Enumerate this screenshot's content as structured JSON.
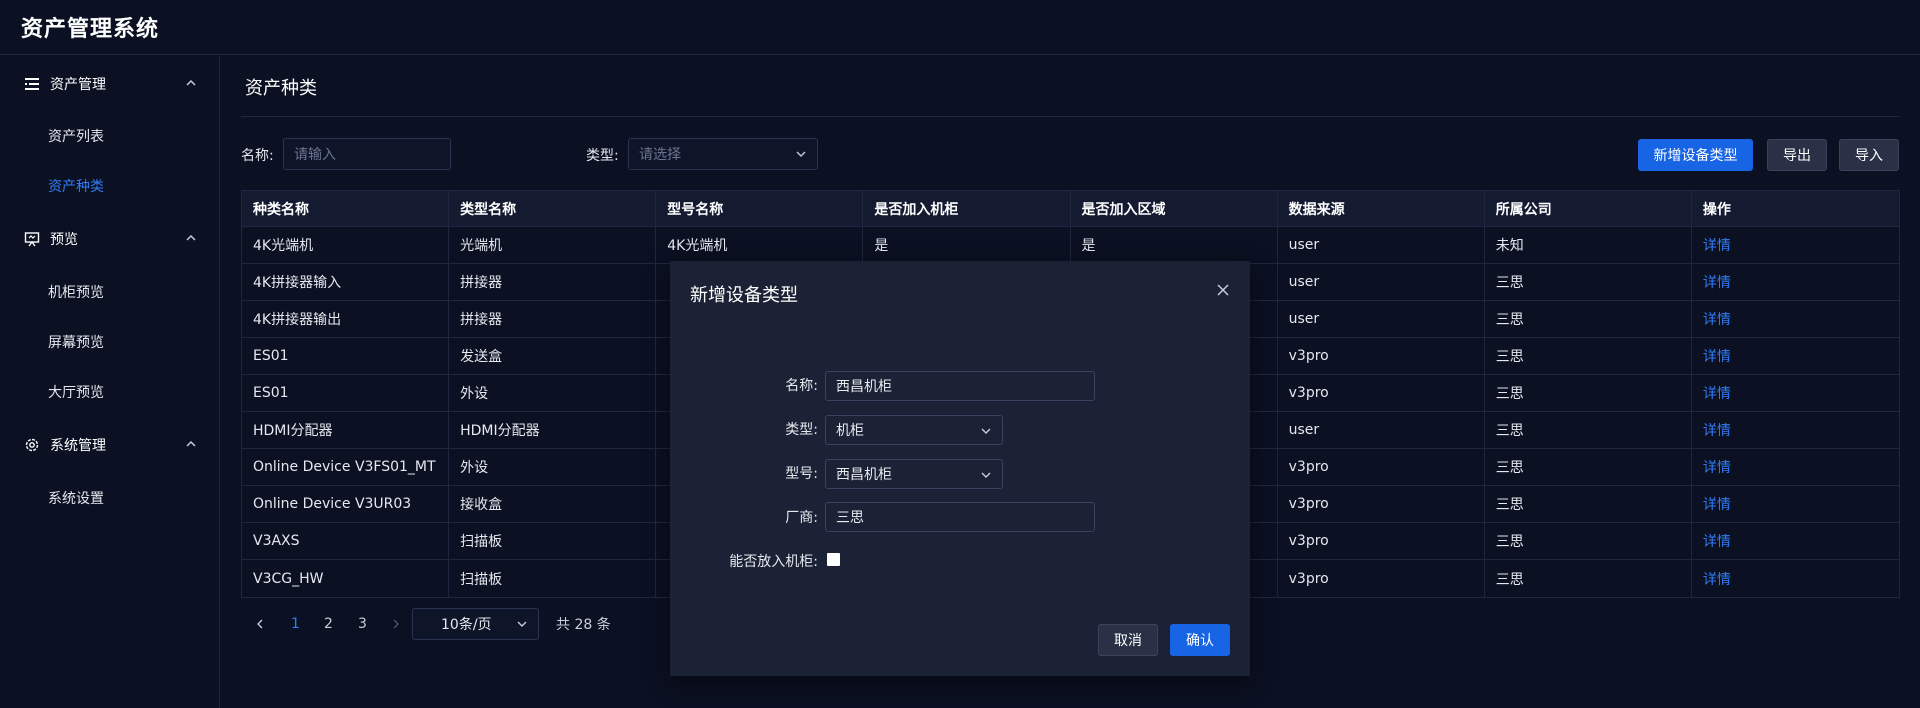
{
  "app": {
    "title": "资产管理系统"
  },
  "sidebar": {
    "groups": [
      {
        "label": "资产管理",
        "icon": "list-icon",
        "items": [
          "资产列表",
          "资产种类"
        ]
      },
      {
        "label": "预览",
        "icon": "presentation-icon",
        "items": [
          "机柜预览",
          "屏幕预览",
          "大厅预览"
        ]
      },
      {
        "label": "系统管理",
        "icon": "gear-icon",
        "items": [
          "系统设置"
        ]
      }
    ],
    "active_item": "资产种类"
  },
  "page": {
    "title": "资产种类"
  },
  "filters": {
    "name_label": "名称:",
    "name_placeholder": "请输入",
    "type_label": "类型:",
    "type_placeholder": "请选择"
  },
  "toolbar": {
    "add_label": "新增设备类型",
    "export_label": "导出",
    "import_label": "导入"
  },
  "table": {
    "columns": [
      "种类名称",
      "类型名称",
      "型号名称",
      "是否加入机柜",
      "是否加入区域",
      "数据来源",
      "所属公司",
      "操作"
    ],
    "rows": [
      [
        "4K光端机",
        "光端机",
        "4K光端机",
        "是",
        "是",
        "user",
        "未知",
        "详情"
      ],
      [
        "4K拼接器输入",
        "拼接器",
        "",
        "",
        "",
        "user",
        "三思",
        "详情"
      ],
      [
        "4K拼接器输出",
        "拼接器",
        "",
        "",
        "",
        "user",
        "三思",
        "详情"
      ],
      [
        "ES01",
        "发送盒",
        "",
        "",
        "",
        "v3pro",
        "三思",
        "详情"
      ],
      [
        "ES01",
        "外设",
        "",
        "",
        "",
        "v3pro",
        "三思",
        "详情"
      ],
      [
        "HDMI分配器",
        "HDMI分配器",
        "",
        "",
        "",
        "user",
        "三思",
        "详情"
      ],
      [
        "Online Device V3FS01_MT",
        "外设",
        "",
        "",
        "",
        "v3pro",
        "三思",
        "详情"
      ],
      [
        "Online Device V3UR03",
        "接收盒",
        "",
        "",
        "",
        "v3pro",
        "三思",
        "详情"
      ],
      [
        "V3AXS",
        "扫描板",
        "",
        "",
        "",
        "v3pro",
        "三思",
        "详情"
      ],
      [
        "V3CG_HW",
        "扫描板",
        "",
        "",
        "",
        "v3pro",
        "三思",
        "详情"
      ]
    ]
  },
  "pagination": {
    "pages": [
      "1",
      "2",
      "3"
    ],
    "current": "1",
    "page_size": "10条/页",
    "total": "共 28 条"
  },
  "modal": {
    "title": "新增设备类型",
    "name_label": "名称:",
    "name_value": "西昌机柜",
    "type_label": "类型:",
    "type_value": "机柜",
    "model_label": "型号:",
    "model_value": "西昌机柜",
    "vendor_label": "厂商:",
    "vendor_value": "三思",
    "cabinet_label": "能否放入机柜:",
    "cancel_label": "取消",
    "confirm_label": "确认"
  }
}
